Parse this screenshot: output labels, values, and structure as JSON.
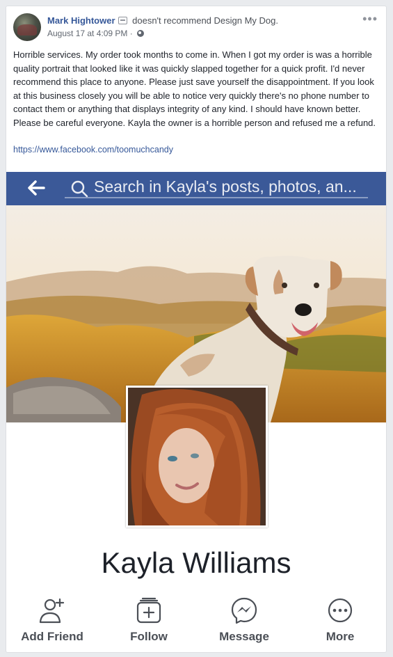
{
  "post": {
    "author": "Mark Hightower",
    "action_text": "doesn't recommend Design My Dog.",
    "timestamp": "August 17 at 4:09 PM",
    "separator": "·",
    "more": "•••",
    "body": "Horrible services. My order took months to come in. When I got my order is was a horrible quality portrait that looked like it was quickly slapped together for a quick profit. I'd never recommend this place to anyone. Please just save yourself the disappointment. If you look at this business closely you will be able to notice very quickly there's no phone number to contact them or anything that displays integrity of any kind. I should have known better. Please be careful everyone. Kayla the owner is a horrible person and refused me a refund.",
    "link": "https://www.facebook.com/toomuchcandy"
  },
  "screenshot": {
    "search_placeholder": "Search in Kayla's posts, photos, an...",
    "profile_name": "Kayla Williams",
    "actions": [
      {
        "label": "Add Friend",
        "icon": "add-friend-icon"
      },
      {
        "label": "Follow",
        "icon": "follow-icon"
      },
      {
        "label": "Message",
        "icon": "messenger-icon"
      },
      {
        "label": "More",
        "icon": "more-icon"
      }
    ]
  },
  "colors": {
    "facebook_blue": "#3b5998",
    "link_blue": "#365899",
    "text": "#1d2129"
  }
}
